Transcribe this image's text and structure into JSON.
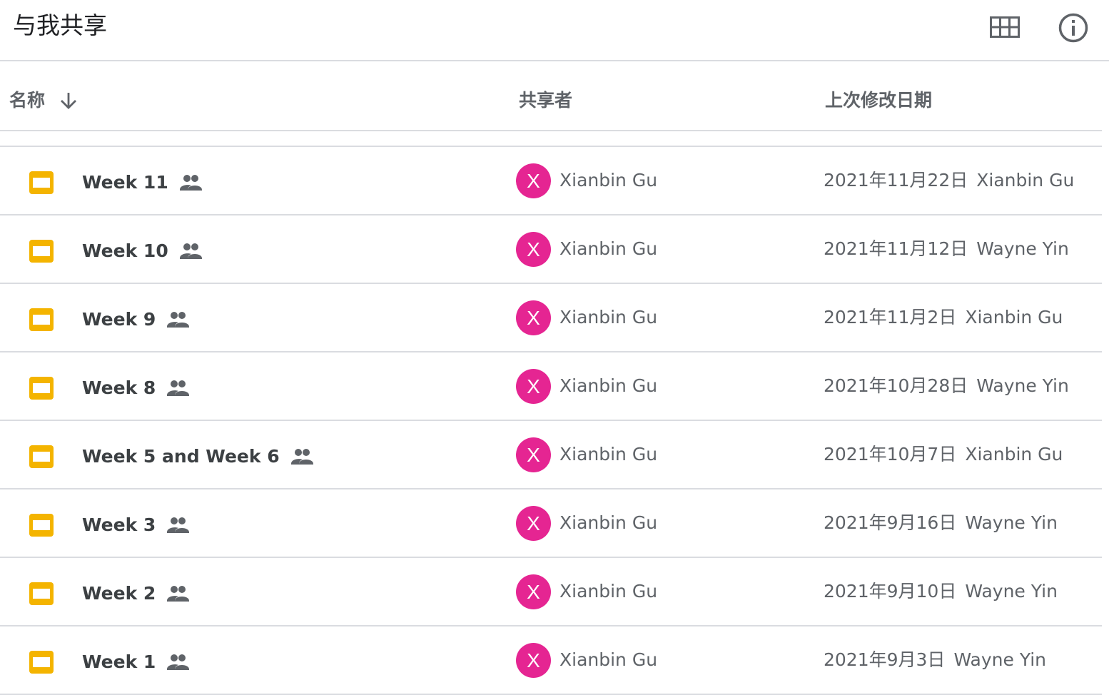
{
  "header": {
    "title": "与我共享"
  },
  "toolbar": {
    "grid_view_icon": "grid-view-icon",
    "info_icon": "info-icon"
  },
  "columns": {
    "name": "名称",
    "owner": "共享者",
    "modified": "上次修改日期",
    "sort_icon": "arrow-down-icon"
  },
  "colors": {
    "slides_yellow": "#f4b400",
    "avatar_pink": "#e52592",
    "divider": "#dadce0"
  },
  "files": [
    {
      "name": "Week 11",
      "owner": "Xianbin Gu",
      "owner_initial": "X",
      "modified_date": "2021年11月22日",
      "modified_by": "Xianbin Gu"
    },
    {
      "name": "Week 10",
      "owner": "Xianbin Gu",
      "owner_initial": "X",
      "modified_date": "2021年11月12日",
      "modified_by": "Wayne Yin"
    },
    {
      "name": "Week 9",
      "owner": "Xianbin Gu",
      "owner_initial": "X",
      "modified_date": "2021年11月2日",
      "modified_by": "Xianbin Gu"
    },
    {
      "name": "Week 8",
      "owner": "Xianbin Gu",
      "owner_initial": "X",
      "modified_date": "2021年10月28日",
      "modified_by": "Wayne Yin"
    },
    {
      "name": "Week 5 and Week 6",
      "owner": "Xianbin Gu",
      "owner_initial": "X",
      "modified_date": "2021年10月7日",
      "modified_by": "Xianbin Gu"
    },
    {
      "name": "Week 3",
      "owner": "Xianbin Gu",
      "owner_initial": "X",
      "modified_date": "2021年9月16日",
      "modified_by": "Wayne Yin"
    },
    {
      "name": "Week 2",
      "owner": "Xianbin Gu",
      "owner_initial": "X",
      "modified_date": "2021年9月10日",
      "modified_by": "Wayne Yin"
    },
    {
      "name": "Week 1",
      "owner": "Xianbin Gu",
      "owner_initial": "X",
      "modified_date": "2021年9月3日",
      "modified_by": "Wayne Yin"
    }
  ]
}
